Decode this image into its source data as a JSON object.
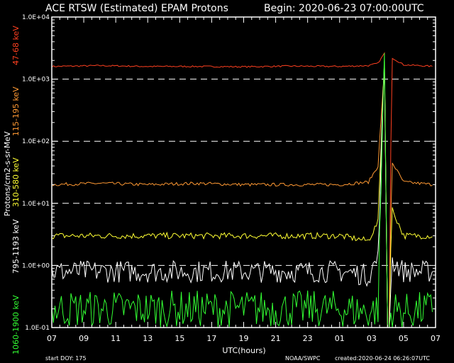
{
  "header": {
    "title": "ACE RTSW (Estimated) EPAM Protons",
    "begin": "Begin: 2020-06-23 07:00:00UTC"
  },
  "footer": {
    "start_doy": "start DOY:  175",
    "credit": "NOAA/SWPC",
    "created": "created:2020-06-24 06:26:07UTC"
  },
  "colors": {
    "background": "#000000",
    "axes": "#ffffff",
    "ch_47_68": "#ff4020",
    "ch_115_195": "#ff9933",
    "ch_310_580": "#ffff33",
    "ch_795_1193": "#ffffff",
    "ch_1060_1900": "#33ff33"
  },
  "chart_data": {
    "type": "line",
    "title": "ACE RTSW (Estimated) EPAM Protons",
    "subtitle": "Begin: 2020-06-23 07:00:00UTC",
    "xlabel": "UTC(hours)",
    "ylabel": "Protons/cm2-s-sr-MeV",
    "x_unit": "hours since 2020-06-23 07:00 UTC",
    "xlim": [
      0,
      24
    ],
    "x_ticks": [
      0,
      2,
      4,
      6,
      8,
      10,
      12,
      14,
      16,
      18,
      20,
      22,
      24
    ],
    "x_tick_labels": [
      "07",
      "09",
      "11",
      "13",
      "15",
      "17",
      "19",
      "21",
      "23",
      "01",
      "03",
      "05",
      "07"
    ],
    "y_scale": "log",
    "ylim": [
      0.1,
      10000
    ],
    "y_tick_labels": [
      "1.0E-01",
      "1.0E+00",
      "1.0E+01",
      "1.0E+02",
      "1.0E+03",
      "1.0E+04"
    ],
    "grid": "dashed horizontal lines at each decade",
    "series": [
      {
        "name": "47-68 keV",
        "color": "#ff4020",
        "baseline": 1600,
        "x": [
          0,
          3,
          6,
          9,
          12,
          15,
          18,
          19.8,
          20.4,
          20.8,
          21.0,
          21.3,
          22.0,
          23.9
        ],
        "y": [
          1600,
          1650,
          1600,
          1600,
          1580,
          1620,
          1600,
          1650,
          1800,
          2600,
          0.1,
          2200,
          1700,
          1600
        ]
      },
      {
        "name": "115-195 keV",
        "color": "#ff9933",
        "baseline": 20,
        "x": [
          0,
          3,
          6,
          9,
          12,
          15,
          18,
          19.8,
          20.4,
          20.8,
          21.0,
          21.3,
          22.0,
          23.9
        ],
        "y": [
          20,
          21,
          20,
          21,
          20,
          20,
          20,
          22,
          40,
          1500,
          0.1,
          45,
          22,
          20
        ]
      },
      {
        "name": "310-580 keV",
        "color": "#ffff33",
        "baseline": 3,
        "x": [
          0,
          3,
          6,
          9,
          12,
          15,
          18,
          19.8,
          20.4,
          20.8,
          21.0,
          21.3,
          22.0,
          23.9
        ],
        "y": [
          3,
          3,
          3,
          3,
          3,
          3,
          3,
          2.5,
          5,
          2000,
          0.1,
          8,
          3,
          3
        ]
      },
      {
        "name": "795-1193 keV",
        "color": "#ffffff",
        "baseline": 0.8,
        "x": [
          0,
          3,
          6,
          9,
          12,
          15,
          18,
          19.8,
          20.4,
          20.8,
          21.0,
          21.3,
          22.0,
          23.9
        ],
        "y": [
          0.8,
          0.8,
          0.8,
          0.8,
          0.8,
          0.8,
          0.8,
          0.7,
          1.3,
          2000,
          0.1,
          1.2,
          0.8,
          0.8
        ]
      },
      {
        "name": "1060-1900 keV",
        "color": "#33ff33",
        "baseline": 0.2,
        "x": [
          0,
          3,
          6,
          9,
          12,
          15,
          18,
          19.8,
          20.4,
          20.8,
          21.0,
          21.3,
          22.0,
          23.9
        ],
        "y": [
          0.2,
          0.2,
          0.2,
          0.2,
          0.2,
          0.2,
          0.2,
          0.18,
          0.2,
          2500,
          0.1,
          0.2,
          0.18,
          0.2
        ]
      }
    ]
  }
}
